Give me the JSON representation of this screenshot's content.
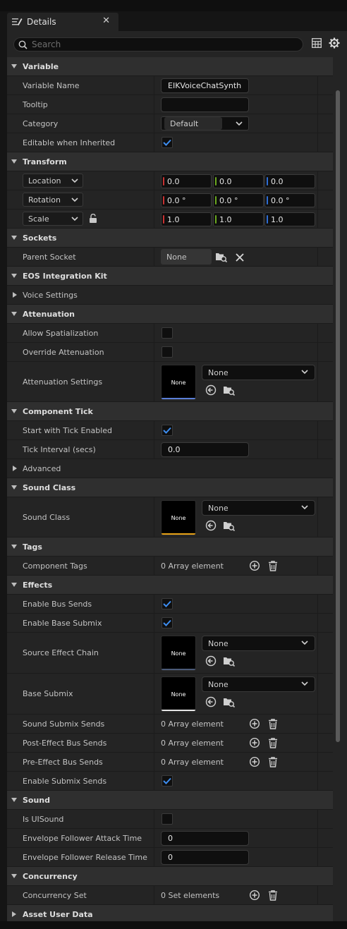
{
  "tab": {
    "title": "Details",
    "close": "✕"
  },
  "search": {
    "placeholder": "Search"
  },
  "variable": {
    "header": "Variable",
    "name_label": "Variable Name",
    "name_value": "EIKVoiceChatSynth",
    "tooltip_label": "Tooltip",
    "tooltip_value": "",
    "category_label": "Category",
    "category_value": "Default",
    "editable_label": "Editable when Inherited"
  },
  "transform": {
    "header": "Transform",
    "location": {
      "label": "Location",
      "x": "0.0",
      "y": "0.0",
      "z": "0.0"
    },
    "rotation": {
      "label": "Rotation",
      "x": "0.0 °",
      "y": "0.0 °",
      "z": "0.0 °"
    },
    "scale": {
      "label": "Scale",
      "x": "1.0",
      "y": "1.0",
      "z": "1.0"
    }
  },
  "sockets": {
    "header": "Sockets",
    "parent_label": "Parent Socket",
    "parent_value": "None"
  },
  "eos": {
    "header": "EOS Integration Kit",
    "voice_settings": "Voice Settings"
  },
  "attenuation": {
    "header": "Attenuation",
    "allow_spatialization": "Allow Spatialization",
    "override_attenuation": "Override Attenuation",
    "settings_label": "Attenuation Settings",
    "thumb": "None",
    "combo": "None"
  },
  "component_tick": {
    "header": "Component Tick",
    "start_label": "Start with Tick Enabled",
    "interval_label": "Tick Interval (secs)",
    "interval_value": "0.0",
    "advanced": "Advanced"
  },
  "sound_class": {
    "header": "Sound Class",
    "label": "Sound Class",
    "thumb": "None",
    "combo": "None"
  },
  "tags": {
    "header": "Tags",
    "label": "Component Tags",
    "value": "0 Array element"
  },
  "effects": {
    "header": "Effects",
    "enable_bus_sends": "Enable Bus Sends",
    "enable_base_submix": "Enable Base Submix",
    "source_effect_chain": {
      "label": "Source Effect Chain",
      "thumb": "None",
      "combo": "None"
    },
    "base_submix": {
      "label": "Base Submix",
      "thumb": "None",
      "combo": "None"
    },
    "sound_submix_sends": {
      "label": "Sound Submix Sends",
      "value": "0 Array element"
    },
    "post_effect_bus_sends": {
      "label": "Post-Effect Bus Sends",
      "value": "0 Array element"
    },
    "pre_effect_bus_sends": {
      "label": "Pre-Effect Bus Sends",
      "value": "0 Array element"
    },
    "enable_submix_sends": "Enable Submix Sends"
  },
  "sound": {
    "header": "Sound",
    "is_ui_sound": "Is UISound",
    "attack_label": "Envelope Follower Attack Time",
    "attack_value": "0",
    "release_label": "Envelope Follower Release Time",
    "release_value": "0"
  },
  "concurrency": {
    "header": "Concurrency",
    "label": "Concurrency Set",
    "value": "0 Set elements"
  },
  "asset_user_data": {
    "header": "Asset User Data"
  },
  "colors": {
    "accent_blue": "#2f7de1",
    "axis_x": "#c83232",
    "axis_y": "#6aa81e",
    "axis_z": "#2f6fd6",
    "sound_class_line": "#e8a317",
    "attenuation_line": "#5a7fd8"
  }
}
